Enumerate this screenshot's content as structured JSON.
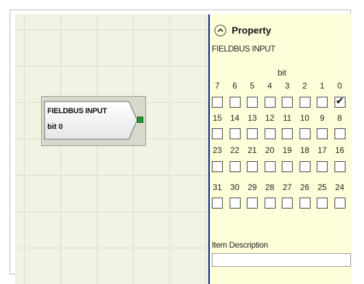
{
  "canvas": {
    "block": {
      "title": "FIELDBUS INPUT",
      "subtitle": "bit 0",
      "output_port_color": "#1a9a2a"
    }
  },
  "property": {
    "title": "Property",
    "collapse_icon": "chevron-up-circle-icon",
    "item_type": "FIELDBUS INPUT",
    "bit_header": "bit",
    "rows": [
      {
        "labels": [
          "7",
          "6",
          "5",
          "4",
          "3",
          "2",
          "1",
          "0"
        ],
        "checked": [
          false,
          false,
          false,
          false,
          false,
          false,
          false,
          true
        ]
      },
      {
        "labels": [
          "15",
          "14",
          "13",
          "12",
          "11",
          "10",
          "9",
          "8"
        ],
        "checked": [
          false,
          false,
          false,
          false,
          false,
          false,
          false,
          false
        ]
      },
      {
        "labels": [
          "23",
          "22",
          "21",
          "20",
          "19",
          "18",
          "17",
          "16"
        ],
        "checked": [
          false,
          false,
          false,
          false,
          false,
          false,
          false,
          false
        ]
      },
      {
        "labels": [
          "31",
          "30",
          "29",
          "28",
          "27",
          "26",
          "25",
          "24"
        ],
        "checked": [
          false,
          false,
          false,
          false,
          false,
          false,
          false,
          false
        ]
      }
    ],
    "description_label": "Item Description",
    "description_value": ""
  }
}
